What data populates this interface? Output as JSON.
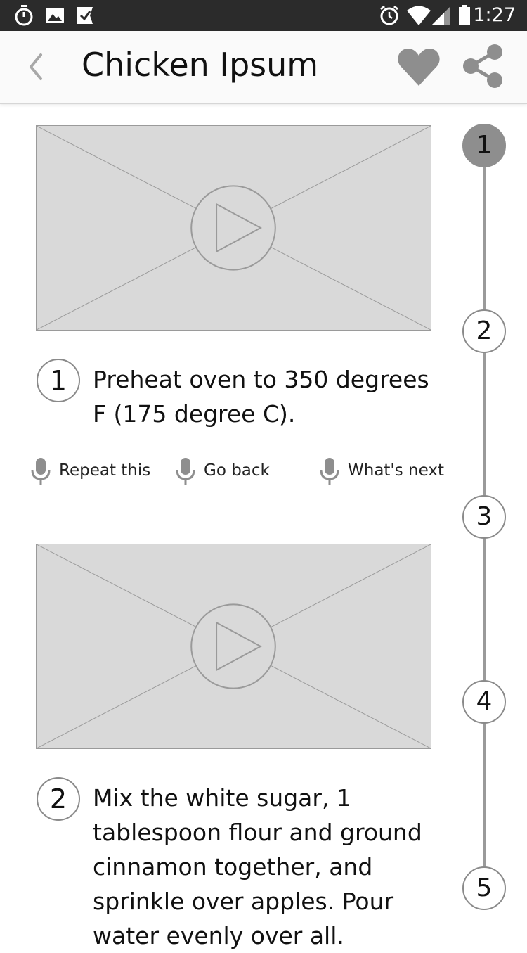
{
  "status_bar": {
    "time": "1:27",
    "left_icons": [
      "stopwatch-icon",
      "image-icon",
      "task-check-icon"
    ],
    "right_icons": [
      "alarm-icon",
      "wifi-icon",
      "signal-icon",
      "battery-icon"
    ]
  },
  "app_bar": {
    "title": "Chicken Ipsum",
    "back_icon": "chevron-left-icon",
    "favorite_icon": "heart-icon",
    "share_icon": "share-icon"
  },
  "timeline": {
    "steps": [
      "1",
      "2",
      "3",
      "4",
      "5"
    ],
    "active_step": "1"
  },
  "steps": [
    {
      "number": "1",
      "lines": [
        "Preheat oven to 350 degrees",
        "F (175 degree C)."
      ]
    },
    {
      "number": "2",
      "lines": [
        "Mix the white sugar, 1",
        "tablespoon flour and ground",
        "cinnamon together, and",
        "sprinkle over apples. Pour",
        "water evenly over all."
      ]
    }
  ],
  "voice_commands": {
    "repeat": "Repeat this",
    "back": "Go back",
    "next": "What's next"
  },
  "colors": {
    "status_bar_bg": "#2b2b2b",
    "app_bar_bg": "#fafafa",
    "placeholder_bg": "#d9d9d9",
    "icon_gray": "#8e8e8e",
    "active_step_fill": "#8e8e8e"
  }
}
